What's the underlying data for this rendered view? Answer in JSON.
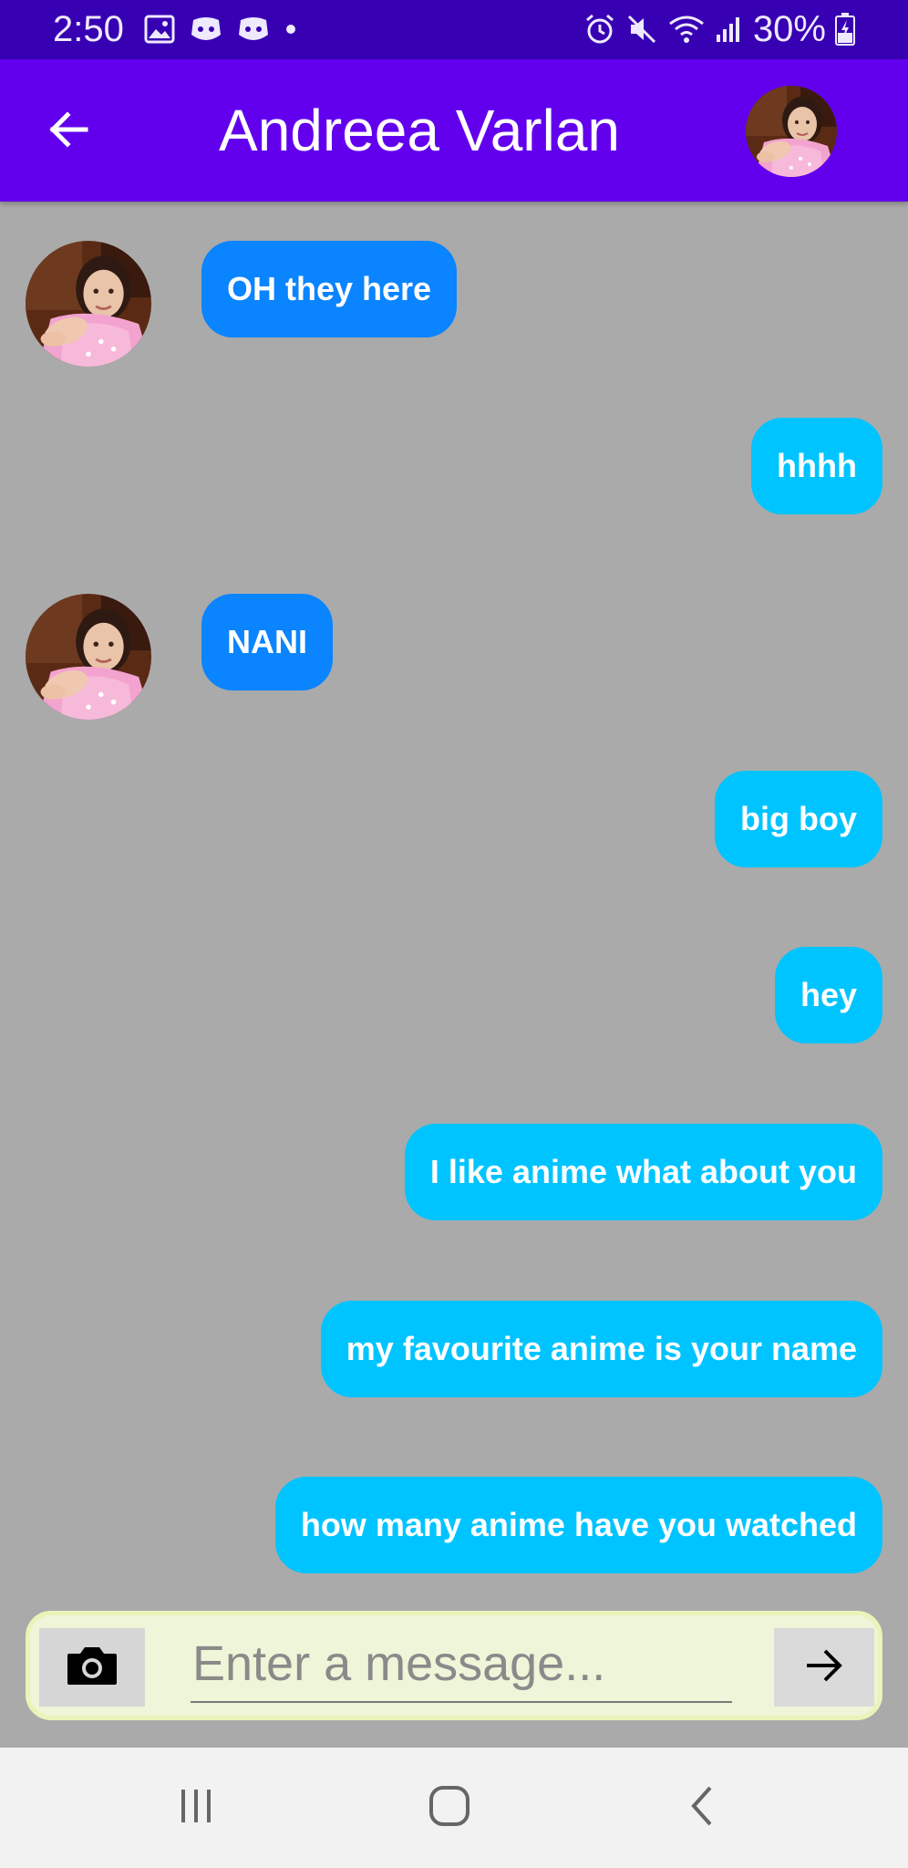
{
  "status_bar": {
    "time": "2:50",
    "battery": "30%",
    "icons": [
      "gallery-icon",
      "discord-icon",
      "discord-icon",
      "dot-icon",
      "alarm-icon",
      "mute-icon",
      "wifi-icon",
      "signal-icon",
      "battery-charging-icon"
    ],
    "background": "#3700b3"
  },
  "header": {
    "title": "Andreea Varlan",
    "back_icon": "arrow-back-icon",
    "background": "#6200ee"
  },
  "messages": [
    {
      "direction": "received",
      "text": "OH they here",
      "has_avatar": true
    },
    {
      "direction": "sent",
      "text": "hhhh"
    },
    {
      "direction": "received",
      "text": "NANI",
      "has_avatar": true
    },
    {
      "direction": "sent",
      "text": "big boy"
    },
    {
      "direction": "sent",
      "text": "hey"
    },
    {
      "direction": "sent",
      "text": "I like anime what about you"
    },
    {
      "direction": "sent",
      "text": "my favourite anime is your name"
    },
    {
      "direction": "sent",
      "text": "how many anime have you watched"
    }
  ],
  "colors": {
    "received_bubble": "#0a84ff",
    "sent_bubble": "#00c4ff",
    "chat_background": "#aaaaaa",
    "input_bar": "#eef5d8"
  },
  "composer": {
    "placeholder": "Enter a message...",
    "value": "",
    "camera_icon": "camera-icon",
    "send_icon": "arrow-forward-icon"
  },
  "nav_bar": {
    "buttons": [
      "recent-apps-icon",
      "home-icon",
      "back-icon"
    ]
  }
}
